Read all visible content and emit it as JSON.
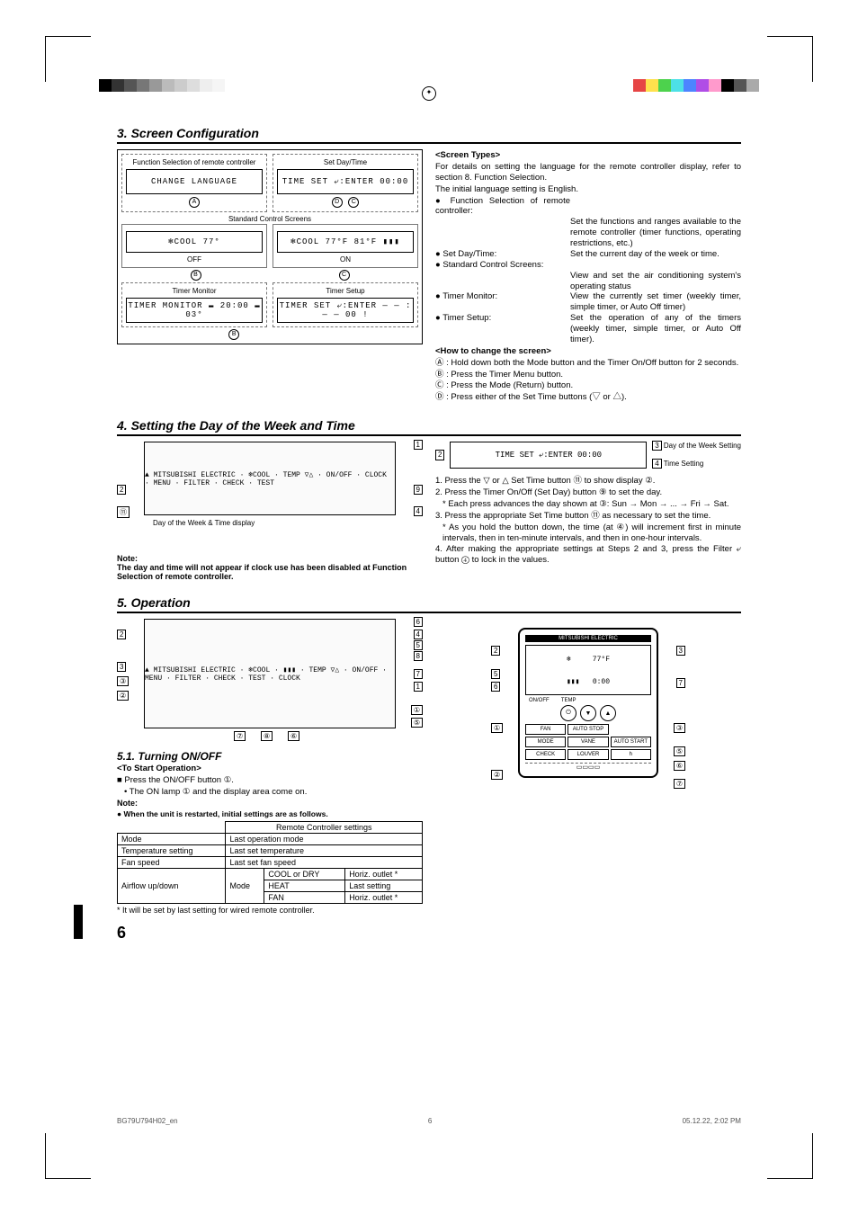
{
  "sections": {
    "s3": {
      "title": "3. Screen Configuration",
      "boxes": {
        "funcSel": "Function Selection of remote controller",
        "setDay": "Set Day/Time",
        "stdCtrl": "Standard Control Screens",
        "off": "OFF",
        "on": "ON",
        "timerMon": "Timer Monitor",
        "timerSetup": "Timer Setup",
        "lcd_change": "CHANGE LANGUAGE",
        "lcd_timeset": "TIME SET ⤶:ENTER   00:00",
        "lcd_cool_off": "❄COOL  77°",
        "lcd_cool_on": "❄COOL  77°F  81°F ▮▮▮",
        "lcd_timermon": "TIMER MONITOR  ▬ 20:00  ▬ 03°",
        "lcd_timersetup": "TIMER SET ⤶:ENTER   — — : — —   00 !"
      },
      "screenTypes": {
        "heading": "<Screen Types>",
        "intro1": "For details on setting the language for the remote controller display, refer to section 8. Function Selection.",
        "intro2": "The initial language setting is English.",
        "items": [
          {
            "label": "● Function Selection of remote controller:",
            "text": "Set the functions and ranges available to the remote controller (timer functions, operating restrictions, etc.)"
          },
          {
            "label": "● Set Day/Time:",
            "text": "Set the current day of the week or time."
          },
          {
            "label": "● Standard Control Screens:",
            "text": "View and set the air conditioning system's operating status"
          },
          {
            "label": "● Timer Monitor:",
            "text": "View the currently set timer (weekly timer, simple timer, or Auto Off timer)"
          },
          {
            "label": "● Timer Setup:",
            "text": "Set the operation of any of the timers (weekly timer, simple timer, or Auto Off timer)."
          }
        ],
        "howto": "<How to change the screen>",
        "steps": [
          "Ⓐ : Hold down both the Mode button and the Timer On/Off button for 2 seconds.",
          "Ⓑ : Press the Timer Menu button.",
          "Ⓒ : Press the Mode (Return) button.",
          "Ⓓ : Press either of the Set Time buttons (▽ or △)."
        ]
      }
    },
    "s4": {
      "title": "4. Setting the Day of the Week and Time",
      "noteTitle": "Note:",
      "noteBody": "The day and time will not appear if clock use has been disabled at Function Selection of remote controller.",
      "caption1": "Day of the Week & Time display",
      "legend3": "Day of the Week Setting",
      "legend4": "Time Setting",
      "lcd2": "TIME SET ⤶:ENTER   00:00",
      "steps": [
        "1. Press the ▽ or △ Set Time button ⑪ to show display ②.",
        "2. Press the Timer On/Off (Set Day) button ⑨ to set the day.",
        "* Each press advances the day shown at ③: Sun → Mon → ... → Fri → Sat.",
        "3. Press the appropriate Set Time button ⑪ as necessary to set the time.",
        "* As you hold the button down, the time (at ④) will increment first in minute intervals, then in ten-minute intervals, and then in one-hour intervals.",
        "4. After making the appropriate settings at Steps 2 and 3, press the Filter ⤶ button ④ to lock in the values."
      ]
    },
    "s5": {
      "title": "5. Operation",
      "sub51": "5.1.  Turning ON/OFF",
      "toStart": "<To Start Operation>",
      "press": "■ Press the ON/OFF button ①.",
      "lamp": "• The ON lamp ① and the display area come on.",
      "noteTitle": "Note:",
      "noteLine": "● When the unit is restarted, initial settings are as follows.",
      "table": {
        "header": "Remote Controller settings",
        "rows": [
          [
            "Mode",
            "Last operation mode"
          ],
          [
            "Temperature setting",
            "Last set temperature"
          ],
          [
            "Fan speed",
            "Last set fan speed"
          ]
        ],
        "airflowLabel": "Airflow up/down",
        "modeLabel": "Mode",
        "cells": [
          [
            "COOL or DRY",
            "Horiz. outlet *"
          ],
          [
            "HEAT",
            "Last setting"
          ],
          [
            "FAN",
            "Horiz. outlet *"
          ]
        ]
      },
      "footnote": "* It will be set by last setting for wired remote controller.",
      "remoteBrand": "MITSUBISHI ELECTRIC",
      "remoteBtns": [
        "ON/OFF",
        "TEMP",
        "FAN",
        "AUTO STOP",
        "MODE",
        "VANE",
        "AUTO START",
        "CHECK",
        "LOUVER",
        "h"
      ]
    }
  },
  "pagenum": "6",
  "footer": {
    "left": "BG79U794H02_en",
    "mid": "6",
    "right": "05.12.22, 2:02 PM"
  }
}
